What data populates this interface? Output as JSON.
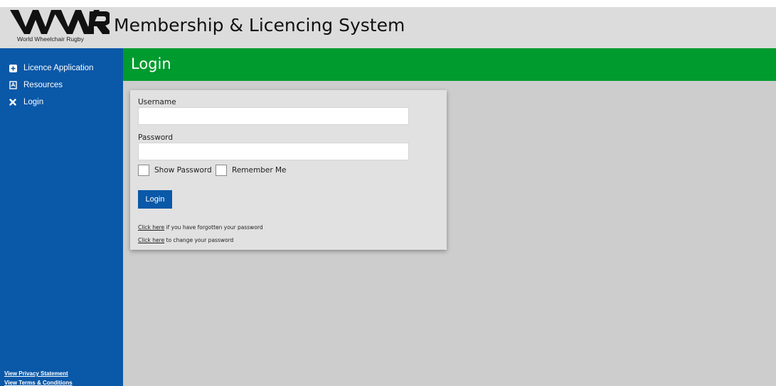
{
  "header": {
    "logo_caption": "World Wheelchair Rugby",
    "app_title": "Membership & Licencing System"
  },
  "sidebar": {
    "items": [
      {
        "label": "Licence Application",
        "icon": "plus-square-icon"
      },
      {
        "label": "Resources",
        "icon": "document-icon"
      },
      {
        "label": "Login",
        "icon": "close-icon"
      }
    ],
    "footer_links": [
      "View Privacy Statement",
      "View Terms & Conditions"
    ]
  },
  "main": {
    "title": "Login",
    "form": {
      "username_label": "Username",
      "username_value": "",
      "password_label": "Password",
      "password_value": "",
      "show_password_label": "Show Password",
      "remember_me_label": "Remember Me",
      "login_button": "Login",
      "forgot_link": "Click here",
      "forgot_text": " if you have forgotten your password",
      "change_link": "Click here",
      "change_text": " to change your password"
    }
  },
  "colors": {
    "sidebar": "#0a58a8",
    "header_green": "#009b2e",
    "background": "#cdcdcd"
  }
}
